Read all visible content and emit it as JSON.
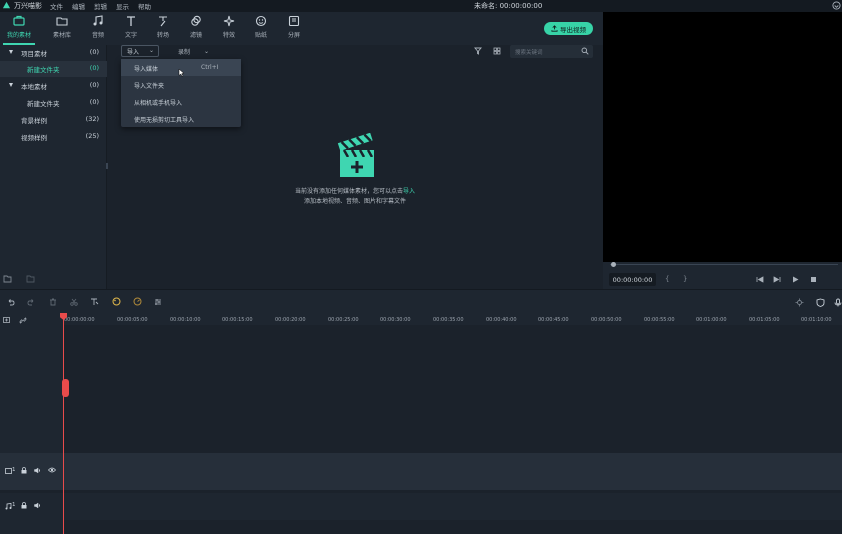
{
  "app": {
    "name": "万兴喵影",
    "title": "未命名: 00:00:00:00"
  },
  "menu": [
    "文件",
    "编辑",
    "剪辑",
    "显示",
    "帮助"
  ],
  "toolbar": {
    "tabs": [
      {
        "label": "我的素材",
        "icon": "folder-box-icon",
        "active": true
      },
      {
        "label": "素材库",
        "icon": "folder-icon"
      },
      {
        "label": "音频",
        "icon": "music-note-icon"
      },
      {
        "label": "文字",
        "icon": "text-t-icon"
      },
      {
        "label": "转场",
        "icon": "transition-icon"
      },
      {
        "label": "滤镜",
        "icon": "filter-icon"
      },
      {
        "label": "特效",
        "icon": "sparkle-icon"
      },
      {
        "label": "贴纸",
        "icon": "sticker-icon"
      },
      {
        "label": "分屏",
        "icon": "split-screen-icon"
      }
    ],
    "export_label": "导出视频"
  },
  "tree": [
    {
      "name": "项目素材",
      "count": "(0)",
      "expandable": true
    },
    {
      "name": "新建文件夹",
      "count": "(0)",
      "selected": true
    },
    {
      "name": "本地素材",
      "count": "(0)",
      "expandable": true
    },
    {
      "name": "新建文件夹",
      "count": "(0)"
    },
    {
      "name": "背景样例",
      "count": "(32)"
    },
    {
      "name": "视频样例",
      "count": "(25)"
    }
  ],
  "media": {
    "import_label": "导入",
    "record_label": "录制",
    "search_placeholder": "搜索关键词",
    "empty_line1": "当前没有添加任何媒体素材，您可以点击",
    "empty_link": "导入",
    "empty_line2": "添加本地视频、音频、图片和字幕文件"
  },
  "dropdown": [
    {
      "label": "导入媒体",
      "shortcut": "Ctrl+I",
      "highlighted": true
    },
    {
      "label": "导入文件夹",
      "shortcut": ""
    },
    {
      "label": "从相机或手机导入",
      "shortcut": ""
    },
    {
      "label": "使用无损剪切工具导入",
      "shortcut": ""
    }
  ],
  "preview": {
    "timecode": "00:00:00:00"
  },
  "timeline": {
    "ticks": [
      "00:00:00:00",
      "00:00:05:00",
      "00:00:10:00",
      "00:00:15:00",
      "00:00:20:00",
      "00:00:25:00",
      "00:00:30:00",
      "00:00:35:00",
      "00:00:40:00",
      "00:00:45:00",
      "00:00:50:00",
      "00:00:55:00",
      "00:01:00:00",
      "00:01:05:00",
      "00:01:10:00"
    ],
    "video_track_label": "1",
    "audio_track_label": "1"
  },
  "colors": {
    "accent": "#3fd6b1",
    "playhead": "#e84b4b",
    "export": "#37d3a7"
  }
}
